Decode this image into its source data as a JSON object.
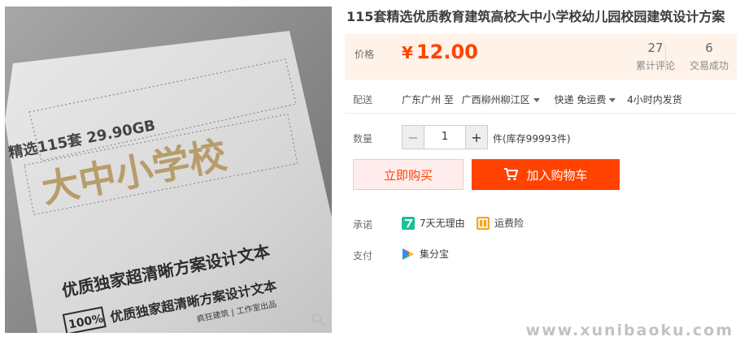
{
  "product_image": {
    "line1": "精选115套 29.90GB",
    "line2": "大中小学校",
    "line3": "优质独家超清晰方案设计文本",
    "line4_badge": "100%",
    "line4": "优质独家超清晰方案设计文本",
    "brand": "疯狂建筑 | 工作室出品"
  },
  "title": "115套精选优质教育建筑高校大中小学校幼儿园校园建筑设计方案",
  "price": {
    "label": "价格",
    "currency": "¥",
    "value": "12.00"
  },
  "stats": {
    "reviews_count": "27",
    "reviews_label": "累计评论",
    "deals_count": "6",
    "deals_label": "交易成功"
  },
  "shipping": {
    "label": "配送",
    "from": "广东广州 至",
    "to": "广西柳州柳江区",
    "method": "快递 免运费",
    "dispatch": "4小时内发货"
  },
  "quantity": {
    "label": "数量",
    "value": "1",
    "minus": "−",
    "plus": "+",
    "stock": "件(库存99993件)"
  },
  "actions": {
    "buy_now": "立即购买",
    "add_to_cart": "加入购物车"
  },
  "promise": {
    "label": "承诺",
    "items": [
      {
        "icon": "seven-day-return-icon",
        "text": "7天无理由",
        "color": "#1ebf9c"
      },
      {
        "icon": "shipping-insurance-icon",
        "text": "运费险",
        "color": "#f5a623"
      }
    ]
  },
  "payment": {
    "label": "支付",
    "items": [
      {
        "icon": "jifenbao-icon",
        "text": "集分宝"
      }
    ]
  },
  "watermark": "www.xunibaoku.com",
  "colors": {
    "accent": "#ff4400",
    "cart_button": "#ff4200",
    "price_bg": "#fff2e8"
  }
}
